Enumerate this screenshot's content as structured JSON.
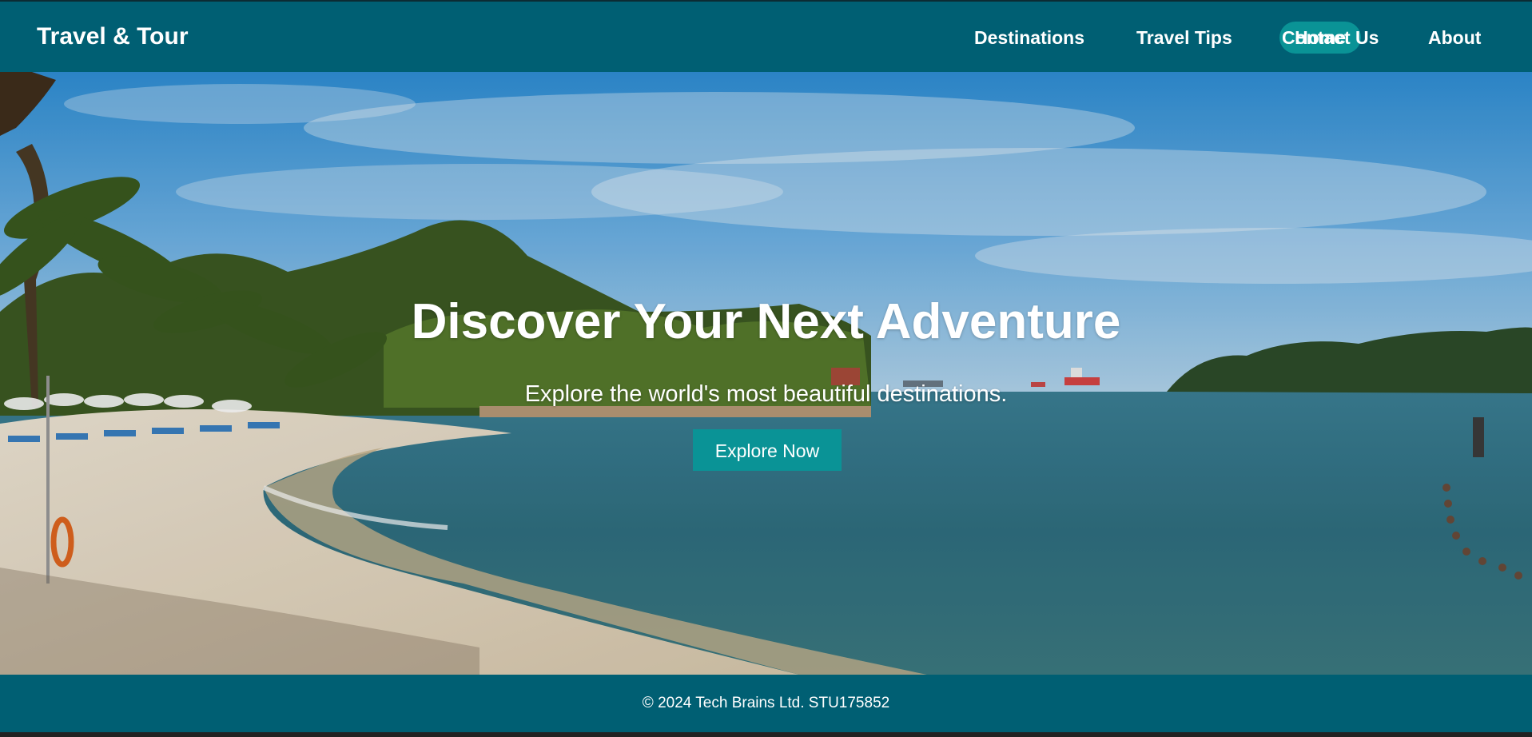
{
  "brand": {
    "name": "Travel & Tour"
  },
  "nav": {
    "items": [
      {
        "label": "Home",
        "active": true
      },
      {
        "label": "Destinations",
        "active": false
      },
      {
        "label": "Travel Tips",
        "active": false
      },
      {
        "label": "Contact Us",
        "active": false
      },
      {
        "label": "About",
        "active": false
      }
    ]
  },
  "hero": {
    "title": "Discover Your Next Adventure",
    "subtitle": "Explore the world's most beautiful destinations.",
    "cta_label": "Explore Now",
    "background": "beach-photo"
  },
  "footer": {
    "text": "© 2024 Tech Brains Ltd. STU175852"
  },
  "colors": {
    "header": "#005f73",
    "accent": "#0a9396",
    "text": "#ffffff"
  }
}
